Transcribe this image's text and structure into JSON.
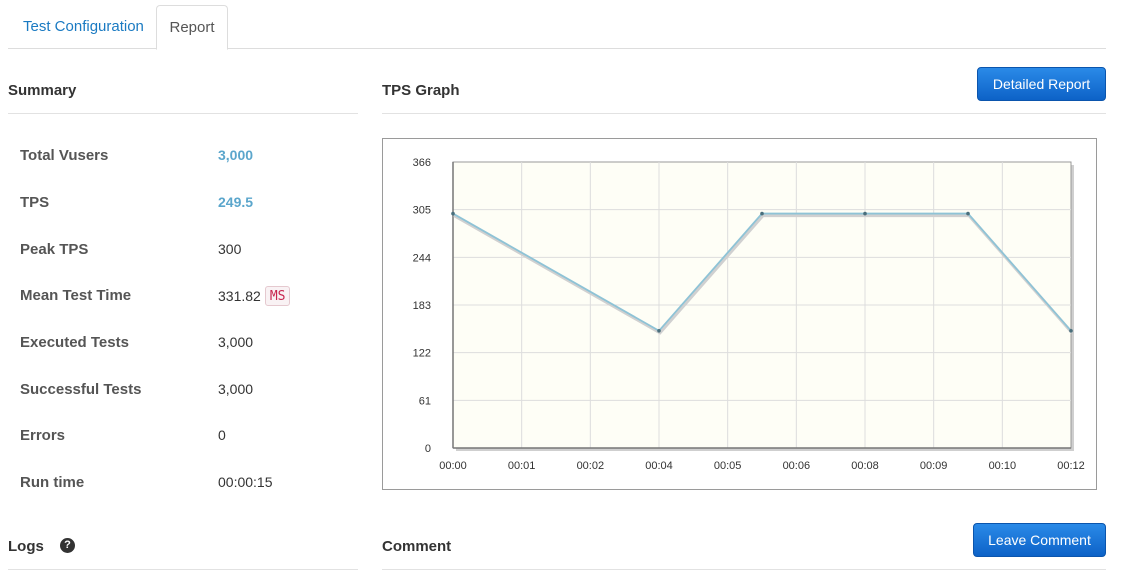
{
  "tabs": [
    {
      "label": "Test Configuration"
    },
    {
      "label": "Report"
    }
  ],
  "summary": {
    "title": "Summary",
    "rows": [
      {
        "label": "Total Vusers",
        "value": "3,000"
      },
      {
        "label": "TPS",
        "value": "249.5"
      },
      {
        "label": "Peak TPS",
        "value": "300"
      },
      {
        "label": "Mean Test Time",
        "value": "331.82",
        "unit": "MS"
      },
      {
        "label": "Executed Tests",
        "value": "3,000"
      },
      {
        "label": "Successful Tests",
        "value": "3,000"
      },
      {
        "label": "Errors",
        "value": "0"
      },
      {
        "label": "Run time",
        "value": "00:00:15"
      }
    ]
  },
  "graph": {
    "title": "TPS Graph",
    "detailed_report_label": "Detailed Report"
  },
  "logs": {
    "title": "Logs",
    "help_icon": "question-circle-icon"
  },
  "comment": {
    "title": "Comment",
    "leave_comment_label": "Leave Comment"
  },
  "colors": {
    "accent": "#1a7ac2",
    "link_value": "#5ba6cc",
    "line": "#8ec3d6",
    "plot_bg": "#fefef6"
  },
  "chart_data": {
    "type": "line",
    "x": [
      "00:00",
      "00:01",
      "00:02",
      "00:04",
      "00:05",
      "00:06",
      "00:08",
      "00:09",
      "00:10",
      "00:12"
    ],
    "x_ticks": [
      "00:00",
      "00:01",
      "00:02",
      "00:04",
      "00:05",
      "00:06",
      "00:08",
      "00:09",
      "00:10",
      "00:12"
    ],
    "y_ticks": [
      0,
      61,
      122,
      183,
      244,
      305,
      366
    ],
    "ylim": [
      0,
      366
    ],
    "points": [
      {
        "x": 0,
        "y": 300
      },
      {
        "x": 3,
        "y": 150
      },
      {
        "x": 4.5,
        "y": 300
      },
      {
        "x": 6,
        "y": 300
      },
      {
        "x": 7.5,
        "y": 300
      },
      {
        "x": 9,
        "y": 150
      }
    ],
    "grid": true
  }
}
